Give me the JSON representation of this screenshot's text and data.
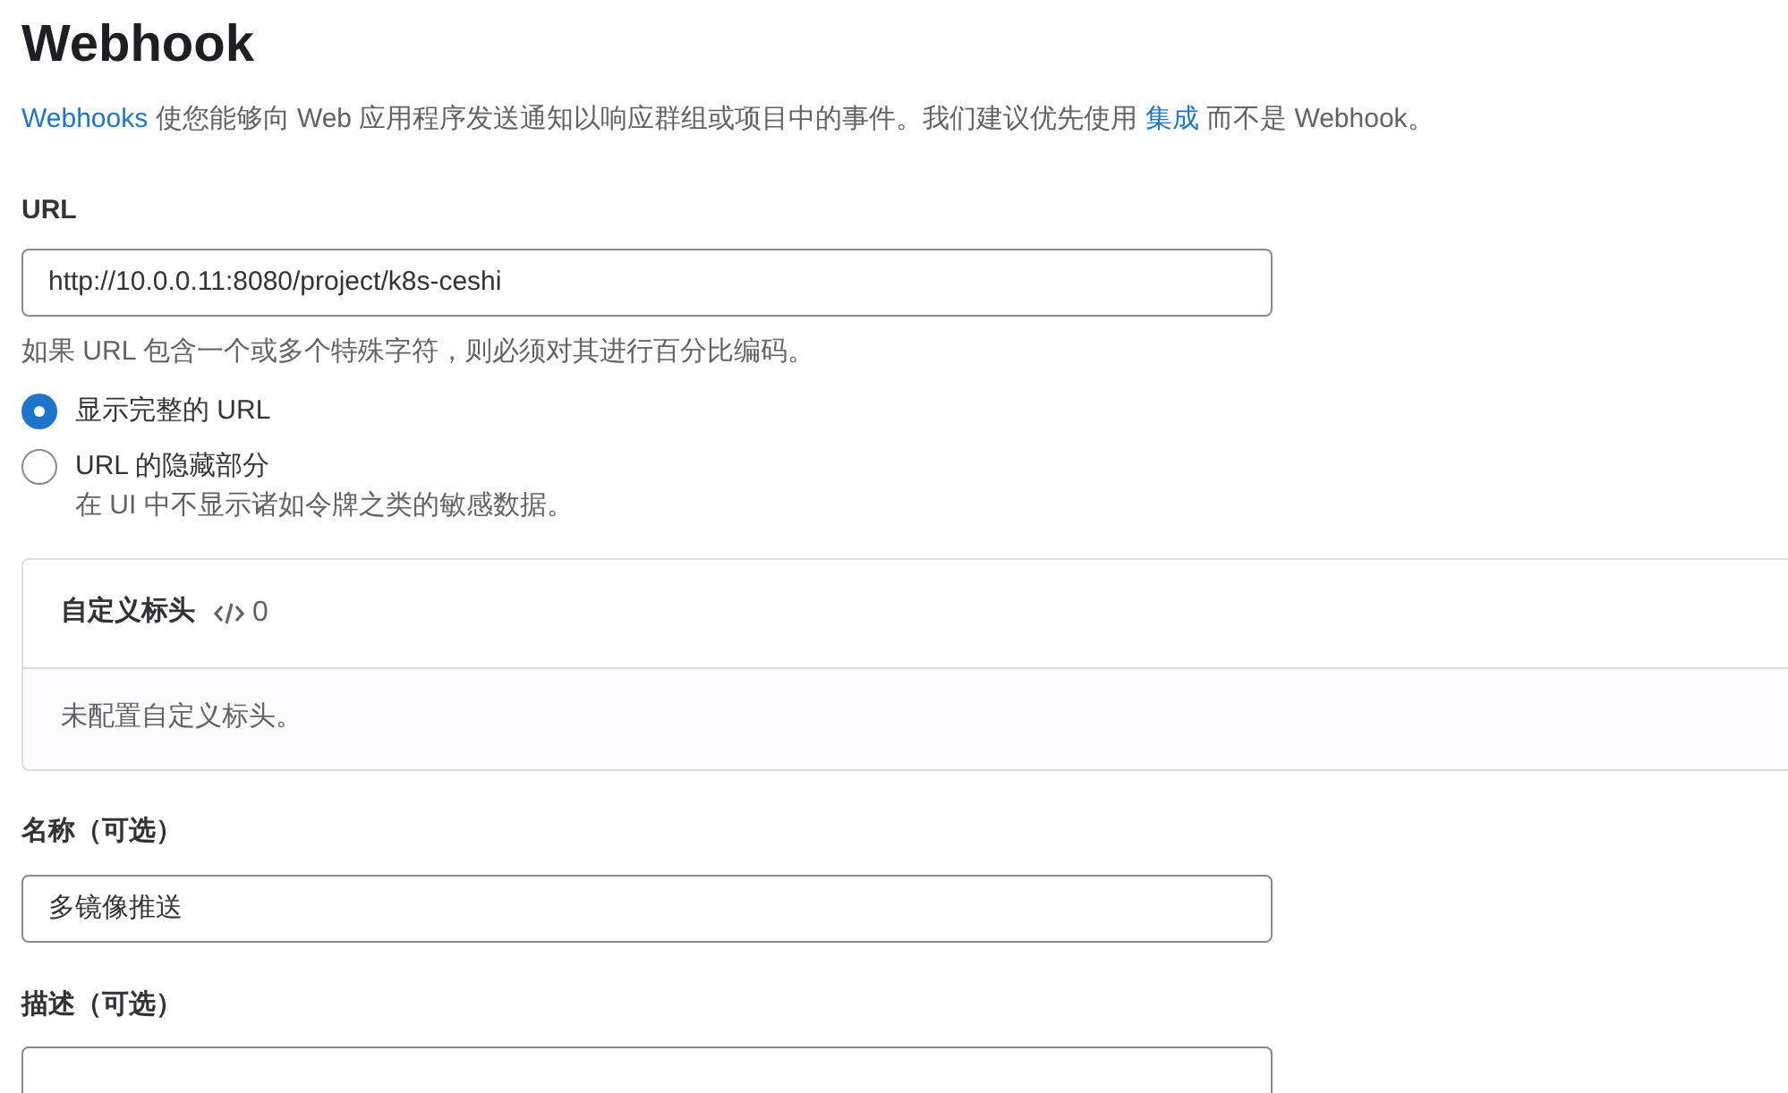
{
  "title": "Webhook",
  "intro": [
    {
      "kind": "link",
      "text": "Webhooks"
    },
    {
      "kind": "text",
      "text": " 使您能够向 Web 应用程序发送通知以响应群组或项目中的事件。我们建议优先使用 "
    },
    {
      "kind": "link",
      "text": "集成"
    },
    {
      "kind": "text",
      "text": " 而不是 Webhook。"
    }
  ],
  "url_field": {
    "label": "URL",
    "value": "http://10.0.0.11:8080/project/k8s-ceshi",
    "help": "如果 URL 包含一个或多个特殊字符，则必须对其进行百分比编码。"
  },
  "url_display": [
    {
      "label": "显示完整的 URL",
      "selected": true
    },
    {
      "label": "URL 的隐藏部分",
      "hint": "在 UI 中不显示诸如令牌之类的敏感数据。",
      "selected": false
    }
  ],
  "custom_headers": {
    "title": "自定义标头",
    "count": "0",
    "empty": "未配置自定义标头。"
  },
  "name_field": {
    "label": "名称（可选）",
    "value": "多镜像推送"
  },
  "description_field": {
    "label": "描述（可选）"
  }
}
